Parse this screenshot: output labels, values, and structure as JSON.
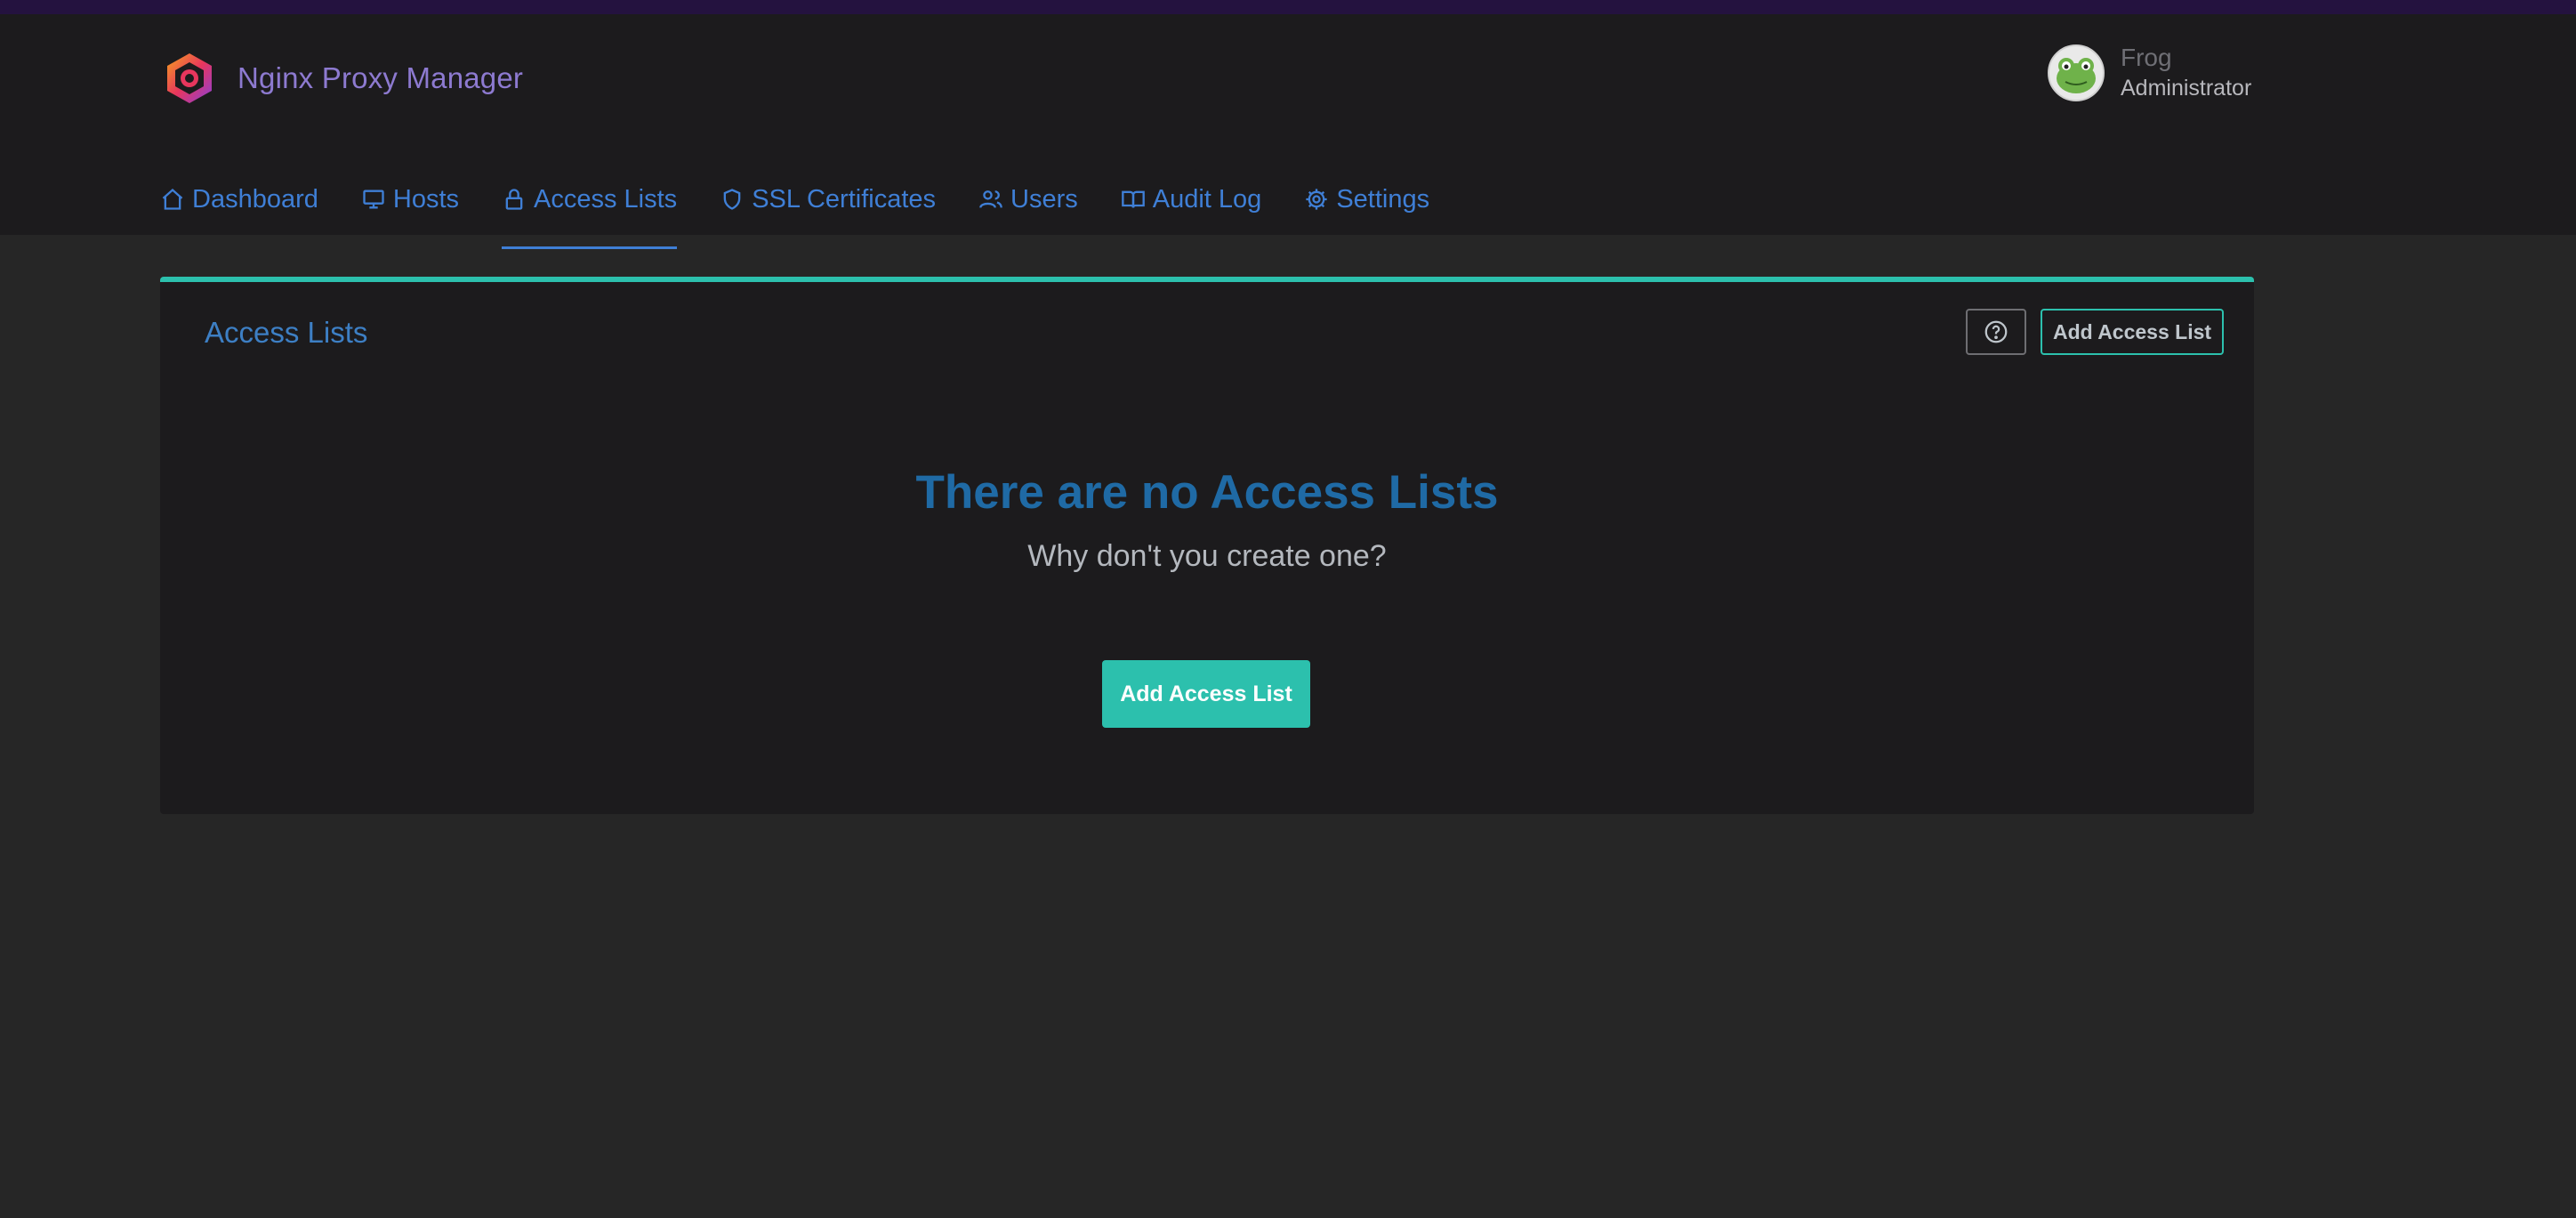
{
  "app": {
    "name": "Nginx Proxy Manager",
    "logo_icon": "nginx-proxy-manager-logo"
  },
  "user": {
    "name": "Frog",
    "role": "Administrator",
    "avatar_icon": "frog-avatar"
  },
  "nav": {
    "items": [
      {
        "label": "Dashboard",
        "icon": "home-icon"
      },
      {
        "label": "Hosts",
        "icon": "monitor-icon"
      },
      {
        "label": "Access Lists",
        "icon": "lock-icon",
        "active": true
      },
      {
        "label": "SSL Certificates",
        "icon": "shield-icon"
      },
      {
        "label": "Users",
        "icon": "users-icon"
      },
      {
        "label": "Audit Log",
        "icon": "book-icon"
      },
      {
        "label": "Settings",
        "icon": "gear-icon"
      }
    ]
  },
  "card": {
    "title": "Access Lists",
    "help_icon": "help-circle-icon",
    "add_button_label": "Add Access List",
    "empty": {
      "title": "There are no Access Lists",
      "subtitle": "Why don't you create one?",
      "button_label": "Add Access List"
    }
  },
  "colors": {
    "accent": "#2cc0ad",
    "link": "#3f7fd6",
    "brand": "#8d7ad0",
    "background": "#262626",
    "panel": "#1c1b1d"
  }
}
